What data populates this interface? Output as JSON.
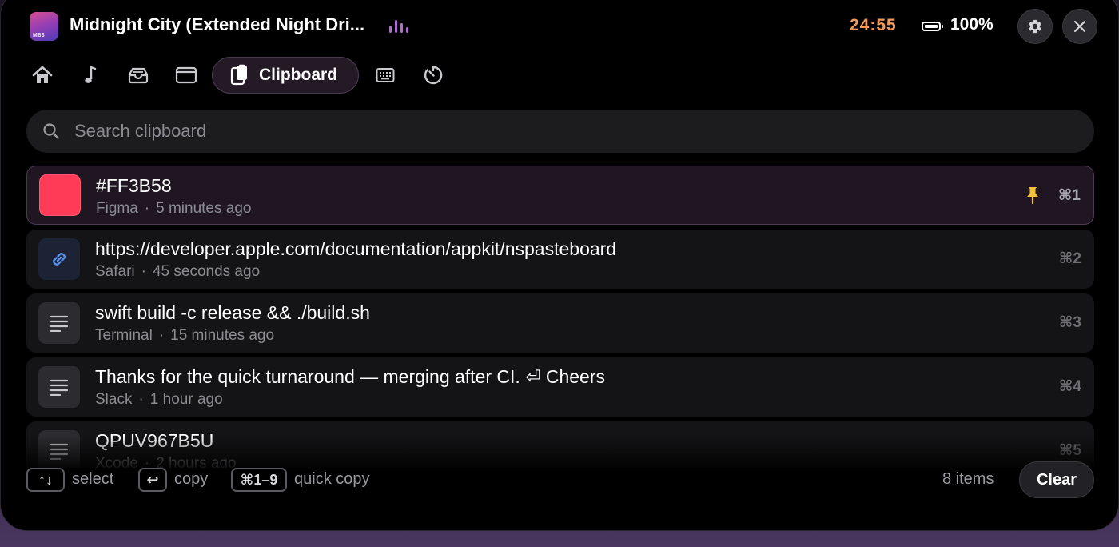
{
  "header": {
    "album_art_text": "M83",
    "track_title": "Midnight City (Extended Night Dri...",
    "timer": "24:55",
    "battery": "100%"
  },
  "tabs": [
    {
      "icon": "home-icon"
    },
    {
      "icon": "music-note-icon"
    },
    {
      "icon": "tray-icon"
    },
    {
      "icon": "window-icon"
    },
    {
      "icon": "clipboard-icon",
      "label": "Clipboard",
      "active": true
    },
    {
      "icon": "keyboard-icon"
    },
    {
      "icon": "timer-icon"
    }
  ],
  "search": {
    "placeholder": "Search clipboard"
  },
  "items": [
    {
      "title": "#FF3B58",
      "source": "Figma",
      "time": "5 minutes ago",
      "shortcut": "⌘1",
      "kind": "color",
      "color": "#FF3B58",
      "pinned": true
    },
    {
      "title": "https://developer.apple.com/documentation/appkit/nspasteboard",
      "source": "Safari",
      "time": "45 seconds ago",
      "shortcut": "⌘2",
      "kind": "link"
    },
    {
      "title": "swift build -c release && ./build.sh",
      "source": "Terminal",
      "time": "15 minutes ago",
      "shortcut": "⌘3",
      "kind": "text"
    },
    {
      "title": "Thanks for the quick turnaround — merging after CI. ⏎ Cheers",
      "source": "Slack",
      "time": "1 hour ago",
      "shortcut": "⌘4",
      "kind": "text"
    },
    {
      "title": "QPUV967B5U",
      "source": "Xcode",
      "time": "2 hours ago",
      "shortcut": "⌘5",
      "kind": "text"
    }
  ],
  "footer": {
    "select_key": "↑↓",
    "select_label": "select",
    "copy_key": "↩",
    "copy_label": "copy",
    "quick_key": "⌘1–9",
    "quick_label": "quick copy",
    "count": "8 items",
    "clear_label": "Clear"
  },
  "colors": {
    "accent_timer": "#f09a5e",
    "accent_eq": "#b06cd6",
    "pin": "#f2c23c"
  }
}
